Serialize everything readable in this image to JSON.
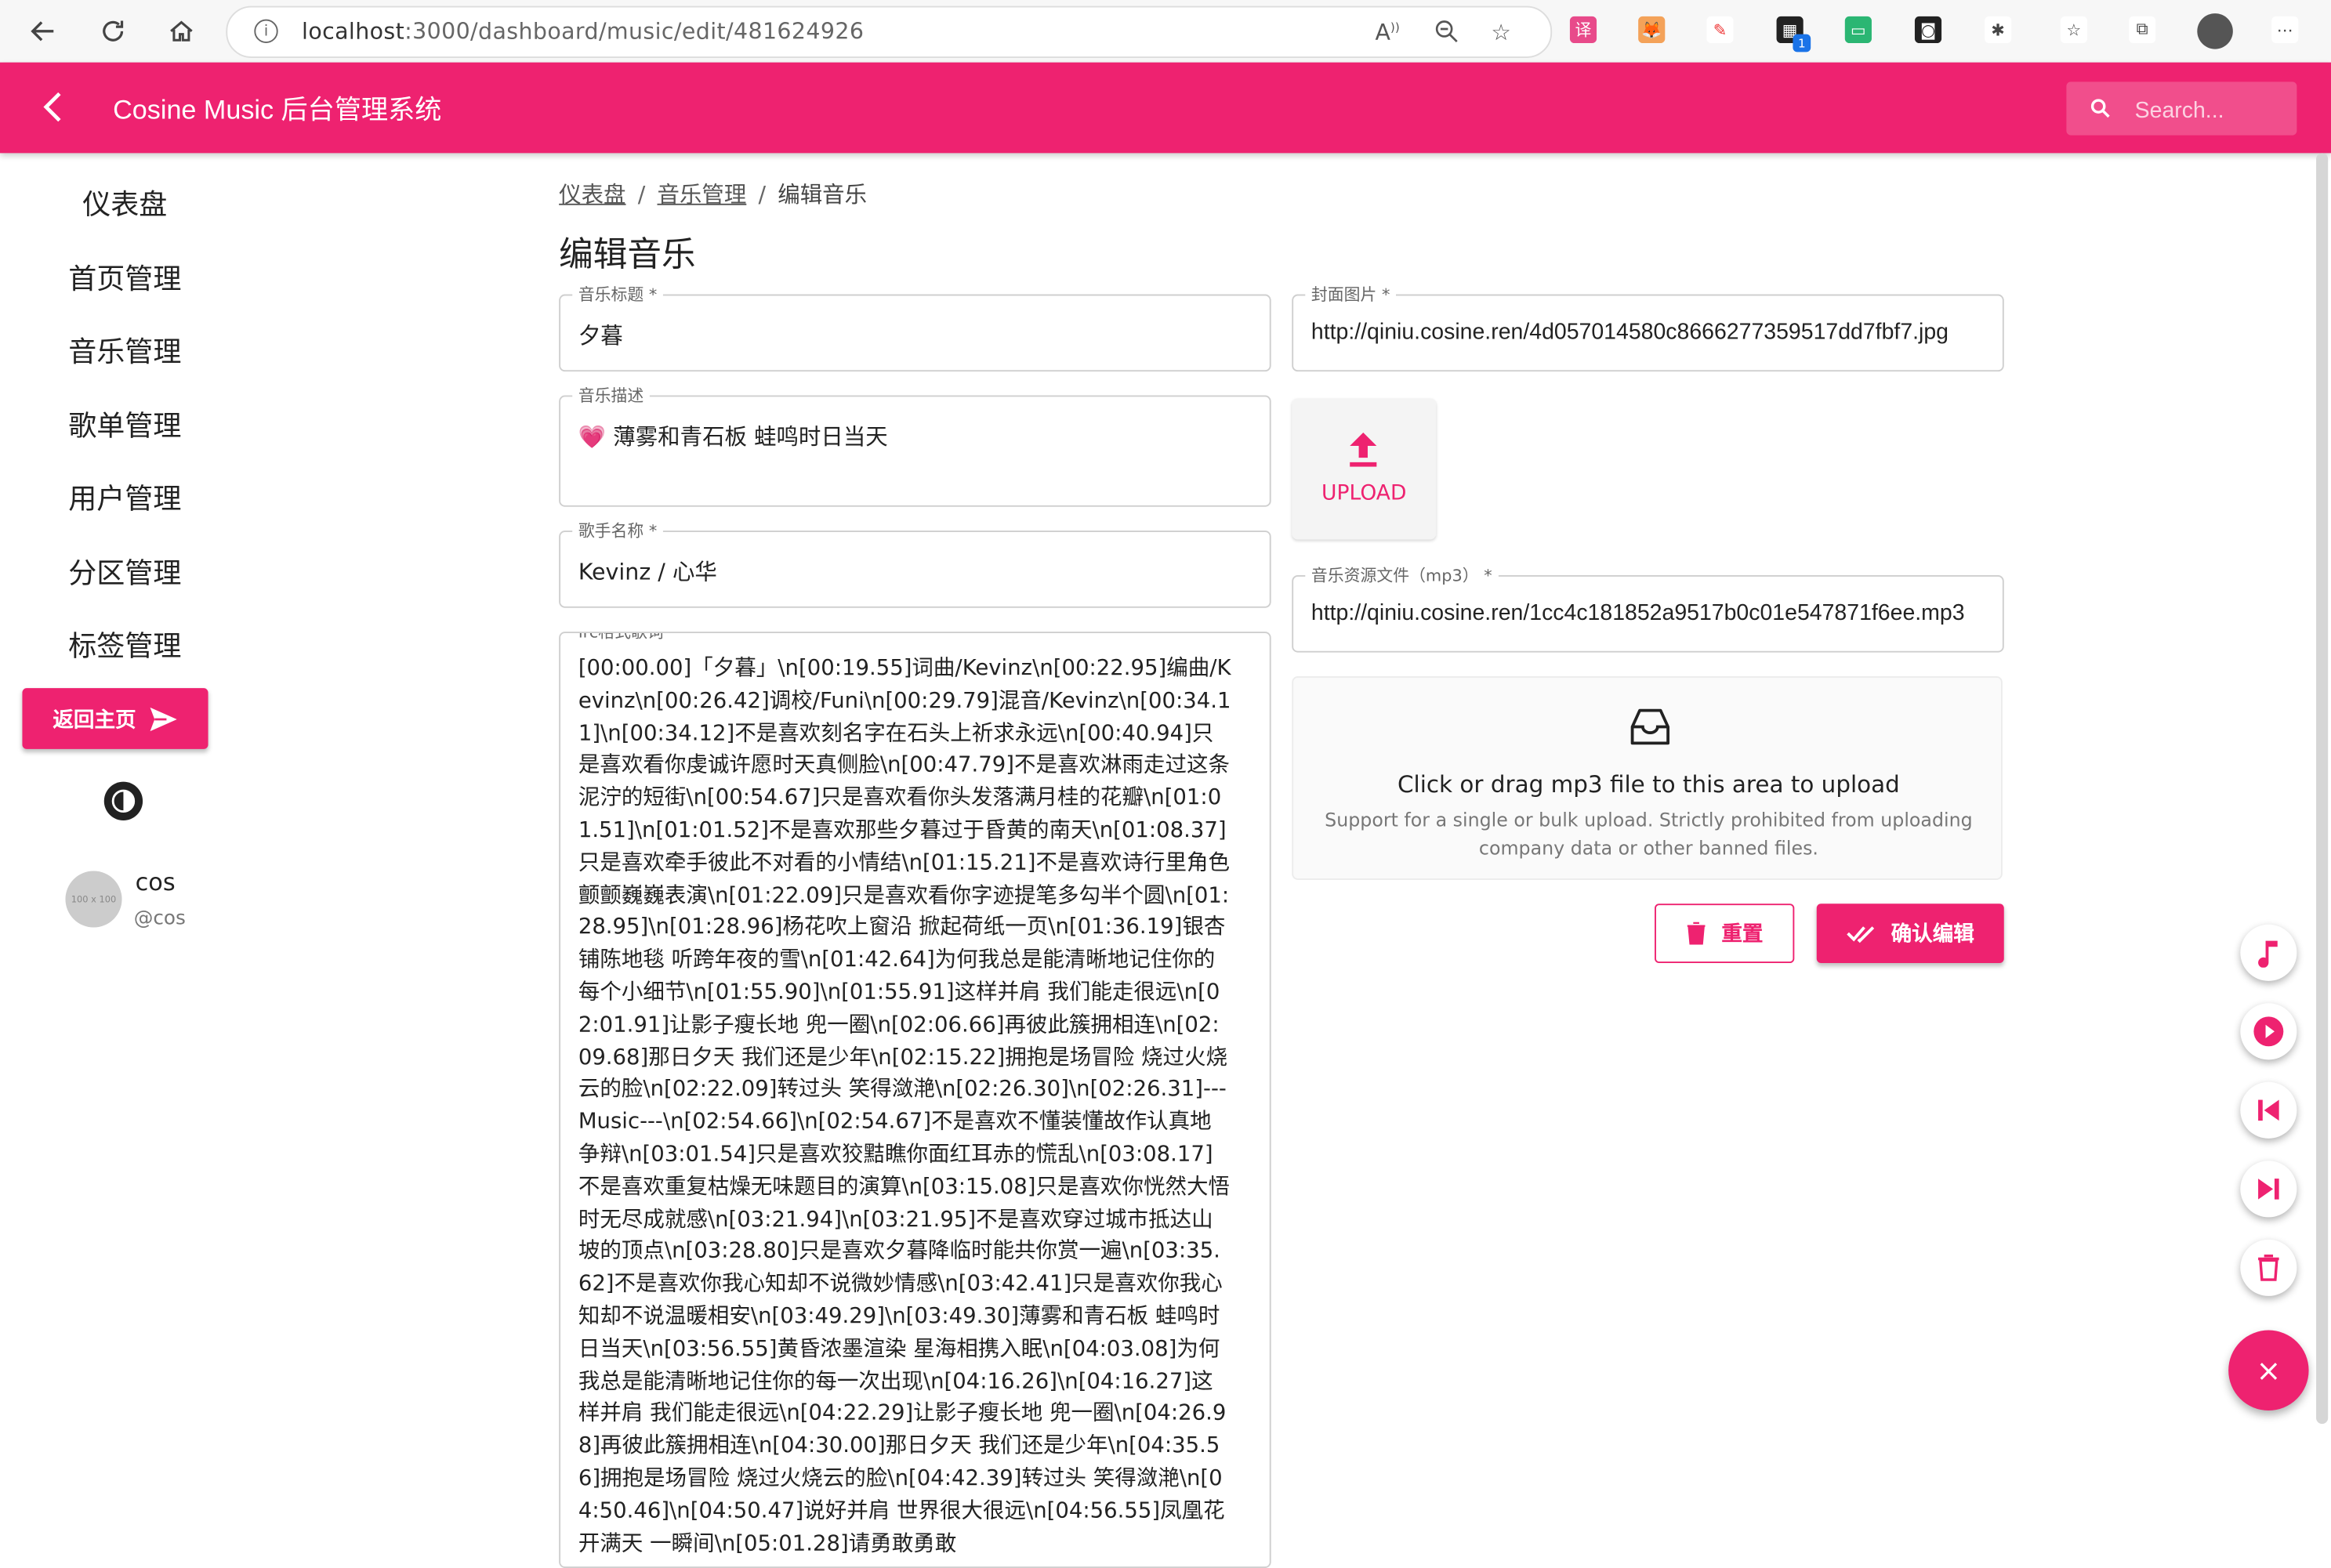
{
  "browser": {
    "url_host": "localhost",
    "url_path": ":3000/dashboard/music/edit/481624926",
    "ext_badge": "1"
  },
  "header": {
    "title": "Cosine Music 后台管理系统",
    "search_placeholder": "Search..."
  },
  "sidebar": {
    "items": [
      {
        "label": "仪表盘"
      },
      {
        "label": "首页管理"
      },
      {
        "label": "音乐管理"
      },
      {
        "label": "歌单管理"
      },
      {
        "label": "用户管理"
      },
      {
        "label": "分区管理"
      },
      {
        "label": "标签管理"
      }
    ],
    "home_button": "返回主页",
    "avatar_text": "100 x 100",
    "user_name": "cos",
    "user_handle": "@cos"
  },
  "breadcrumb": {
    "items": [
      "仪表盘",
      "音乐管理",
      "编辑音乐"
    ],
    "separator": "/"
  },
  "page_title": "编辑音乐",
  "form": {
    "title_label": "音乐标题 *",
    "title_value": "夕暮",
    "desc_label": "音乐描述",
    "desc_value": "💗 薄雾和青石板 蛙鸣时日当天",
    "singer_label": "歌手名称 *",
    "singer_value": "Kevinz / 心华",
    "lrc_label": "lrc格式歌词",
    "lrc_value": "[00:00.00]「夕暮」\\n[00:19.55]词曲/Kevinz\\n[00:22.95]编曲/Kevinz\\n[00:26.42]调校/Funi\\n[00:29.79]混音/Kevinz\\n[00:34.11]\\n[00:34.12]不是喜欢刻名字在石头上祈求永远\\n[00:40.94]只是喜欢看你虔诚许愿时天真侧脸\\n[00:47.79]不是喜欢淋雨走过这条泥泞的短街\\n[00:54.67]只是喜欢看你头发落满月桂的花瓣\\n[01:01.51]\\n[01:01.52]不是喜欢那些夕暮过于昏黄的南天\\n[01:08.37]只是喜欢牵手彼此不对看的小情结\\n[01:15.21]不是喜欢诗行里角色颤颤巍巍表演\\n[01:22.09]只是喜欢看你字迹提笔多勾半个圆\\n[01:28.95]\\n[01:28.96]杨花吹上窗沿 掀起荷纸一页\\n[01:36.19]银杏铺陈地毯 听跨年夜的雪\\n[01:42.64]为何我总是能清晰地记住你的每个小细节\\n[01:55.90]\\n[01:55.91]这样并肩 我们能走很远\\n[02:01.91]让影子瘦长地 兜一圈\\n[02:06.66]再彼此簇拥相连\\n[02:09.68]那日夕天 我们还是少年\\n[02:15.22]拥抱是场冒险 烧过火烧云的脸\\n[02:22.09]转过头 笑得潋滟\\n[02:26.30]\\n[02:26.31]---Music---\\n[02:54.66]\\n[02:54.67]不是喜欢不懂装懂故作认真地争辩\\n[03:01.54]只是喜欢狡黠瞧你面红耳赤的慌乱\\n[03:08.17]不是喜欢重复枯燥无味题目的演算\\n[03:15.08]只是喜欢你恍然大悟时无尽成就感\\n[03:21.94]\\n[03:21.95]不是喜欢穿过城市抵达山坡的顶点\\n[03:28.80]只是喜欢夕暮降临时能共你赏一遍\\n[03:35.62]不是喜欢你我心知却不说微妙情感\\n[03:42.41]只是喜欢你我心知却不说温暖相安\\n[03:49.29]\\n[03:49.30]薄雾和青石板 蛙鸣时日当天\\n[03:56.55]黄昏浓墨渲染 星海相携入眠\\n[04:03.08]为何我总是能清晰地记住你的每一次出现\\n[04:16.26]\\n[04:16.27]这样并肩 我们能走很远\\n[04:22.29]让影子瘦长地 兜一圈\\n[04:26.98]再彼此簇拥相连\\n[04:30.00]那日夕天 我们还是少年\\n[04:35.56]拥抱是场冒险 烧过火烧云的脸\\n[04:42.39]转过头 笑得潋滟\\n[04:50.46]\\n[04:50.47]说好并肩 世界很大很远\\n[04:56.55]凤凰花开满天 一瞬间\\n[05:01.28]请勇敢勇敢",
    "cover_label": "封面图片 *",
    "cover_value": "http://qiniu.cosine.ren/4d057014580c8666277359517dd7fbf7.jpg",
    "upload_label": "UPLOAD",
    "mp3_label": "音乐资源文件（mp3） *",
    "mp3_value": "http://qiniu.cosine.ren/1cc4c181852a9517b0c01e547871f6ee.mp3",
    "drop_title": "Click or drag mp3 file to this area to upload",
    "drop_hint": "Support for a single or bulk upload. Strictly prohibited from uploading company data or other banned files.",
    "reset_label": "重置",
    "confirm_label": "确认编辑"
  },
  "fab": {
    "icons": [
      "music-note-icon",
      "play-icon",
      "skip-previous-icon",
      "skip-next-icon",
      "delete-icon"
    ],
    "close_glyph": "×"
  },
  "colors": {
    "accent": "#ee2270"
  }
}
